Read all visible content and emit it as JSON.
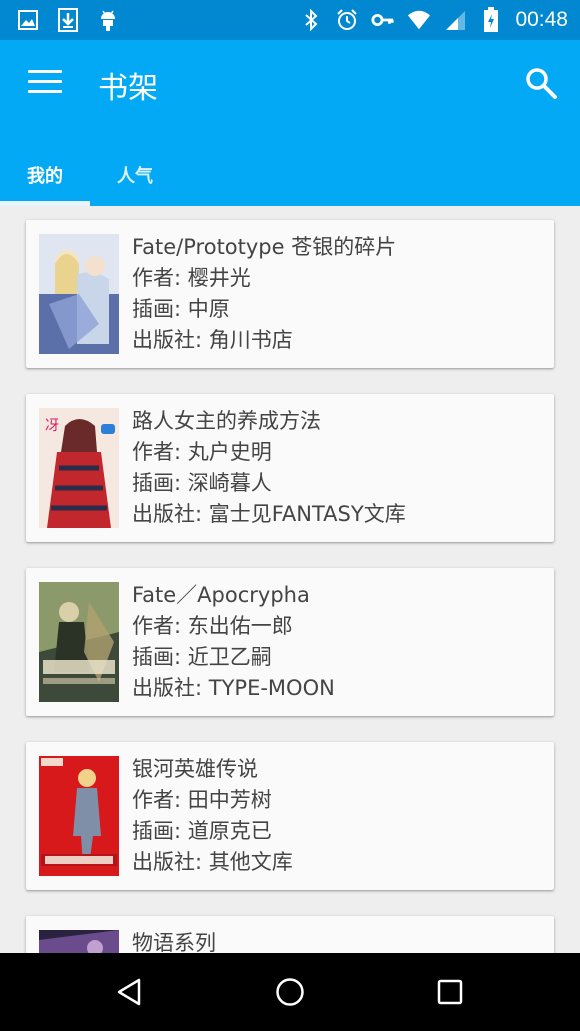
{
  "status_bar": {
    "time": "00:48",
    "left_icons": [
      "image-icon",
      "download-icon",
      "android-icon"
    ],
    "right_icons": [
      "bluetooth-icon",
      "alarm-icon",
      "key-icon",
      "wifi-icon",
      "signal-icon",
      "battery-icon"
    ]
  },
  "appbar": {
    "title": "书架",
    "color": "#03a9f4",
    "status_color": "#0288d1"
  },
  "tabs": [
    {
      "label": "我的",
      "selected": true
    },
    {
      "label": "人气",
      "selected": false
    }
  ],
  "books": [
    {
      "title": "Fate/Prototype 苍银的碎片",
      "author": "作者:  樱井光",
      "illustrator": "插画:  中原",
      "publisher": "出版社:  角川书店",
      "cover_colors": [
        "#c9d6ea",
        "#5b6fa8",
        "#f3e6c7"
      ]
    },
    {
      "title": "路人女主的养成方法",
      "author": "作者:  丸户史明",
      "illustrator": "插画:  深崎暮人",
      "publisher": "出版社:  富士见FANTASY文库",
      "cover_colors": [
        "#f4e8e0",
        "#c1272d",
        "#2b2b4a"
      ]
    },
    {
      "title": "Fate／Apocrypha",
      "author": "作者:  东出佑一郎",
      "illustrator": "插画:  近卫乙嗣",
      "publisher": "出版社:  TYPE-MOON",
      "cover_colors": [
        "#3d4a3a",
        "#8c9a6b",
        "#d9cfa8"
      ]
    },
    {
      "title": "银河英雄传说",
      "author": "作者:  田中芳树",
      "illustrator": "插画:  道原克已",
      "publisher": "出版社:  其他文库",
      "cover_colors": [
        "#d7191c",
        "#7f8fa8",
        "#f6f0e0"
      ]
    },
    {
      "title": "物语系列",
      "author": "",
      "illustrator": "",
      "publisher": "",
      "cover_colors": [
        "#2a2340",
        "#6a4c8c",
        "#c0a0d0"
      ]
    }
  ],
  "navigation": [
    "back-icon",
    "home-icon",
    "recents-icon"
  ]
}
